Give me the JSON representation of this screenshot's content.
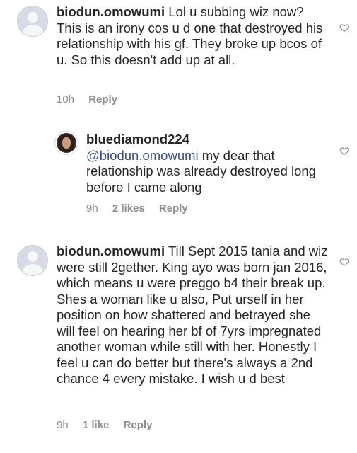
{
  "comments": [
    {
      "username": "biodun.omowumi",
      "text": "Lol u subbing wiz now? This is an irony cos u d one that destroyed his relationship with his gf. They broke up bcos of u. So this doesn't add up at all.",
      "time": "10h",
      "likes": "",
      "reply_label": "Reply"
    },
    {
      "username": "bluediamond224",
      "mention": "@biodun.omowumi",
      "text": "my dear that relationship was already destroyed long before I came along",
      "time": "9h",
      "likes": "2 likes",
      "reply_label": "Reply"
    },
    {
      "username": "biodun.omowumi",
      "text": "Till Sept 2015 tania and wiz were still 2gether. King ayo was born jan 2016, which means u were preggo b4 their break up. Shes a woman like u also, Put urself in her position on how shattered and betrayed she will feel on hearing her bf of 7yrs impregnated another woman while still with her. Honestly I feel u can do better but there's always a 2nd chance 4 every mistake. I wish u d best",
      "time": "9h",
      "likes": "1 like",
      "reply_label": "Reply"
    }
  ],
  "icons": {
    "avatar": "default-avatar-icon",
    "like": "heart-outline-icon"
  }
}
